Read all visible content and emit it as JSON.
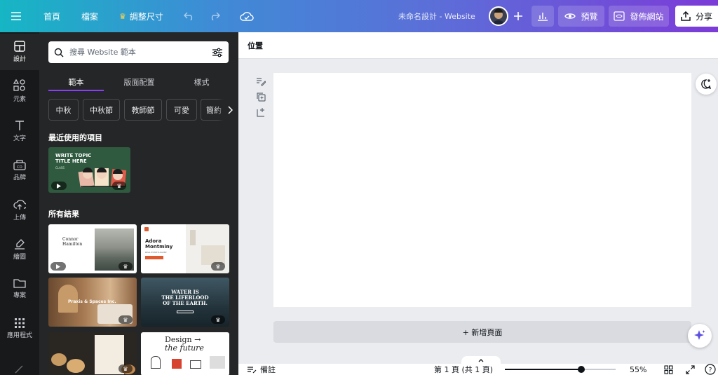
{
  "topbar": {
    "home": "首頁",
    "file": "檔案",
    "resize": "調整尺寸",
    "title": "未命名設計 - Website",
    "preview": "預覽",
    "publish": "發佈網站",
    "share": "分享"
  },
  "rail": {
    "items": [
      {
        "label": "設計",
        "icon": "layout-icon"
      },
      {
        "label": "元素",
        "icon": "shapes-icon"
      },
      {
        "label": "文字",
        "icon": "text-icon"
      },
      {
        "label": "品牌",
        "icon": "brand-icon"
      },
      {
        "label": "上傳",
        "icon": "upload-icon"
      },
      {
        "label": "繪圖",
        "icon": "draw-icon"
      },
      {
        "label": "專案",
        "icon": "folder-icon"
      },
      {
        "label": "應用程式",
        "icon": "apps-icon"
      }
    ]
  },
  "panel": {
    "search_placeholder": "搜尋 Website 範本",
    "tabs": [
      "範本",
      "版面配置",
      "樣式"
    ],
    "chips": [
      "中秋",
      "中秋節",
      "教師節",
      "可愛",
      "簡約"
    ],
    "recent_heading": "最近使用的項目",
    "all_results_heading": "所有結果",
    "recent_thumb": {
      "line1": "WRITE TOPIC",
      "line2": "TITLE HERE",
      "line3": "CLASS"
    },
    "results": {
      "t1_line1": "Connor",
      "t1_line2": "Hamilton",
      "t2_line1": "Adora",
      "t2_line2": "Montminy",
      "t2_line3": "REAL ESTATE AGENT",
      "t3_text": "Praxis & Spaces Inc.",
      "t4_line1": "WATER IS",
      "t4_line2": "THE LIFEBLOOD",
      "t4_line3": "OF THE EARTH.",
      "t6_line1": "Design →",
      "t6_line2": "the future"
    }
  },
  "canvas": {
    "position_label": "位置",
    "add_page": "+ 新增頁面"
  },
  "bottombar": {
    "notes": "備註",
    "page_info": "第 1 頁 (共 1 頁)",
    "zoom": "55%",
    "zoom_fraction": 0.55
  },
  "colors": {
    "accent": "#8b3dff",
    "rail_bg": "#18191b",
    "panel_bg": "#252627",
    "canvas_bg": "#ebecf0"
  }
}
